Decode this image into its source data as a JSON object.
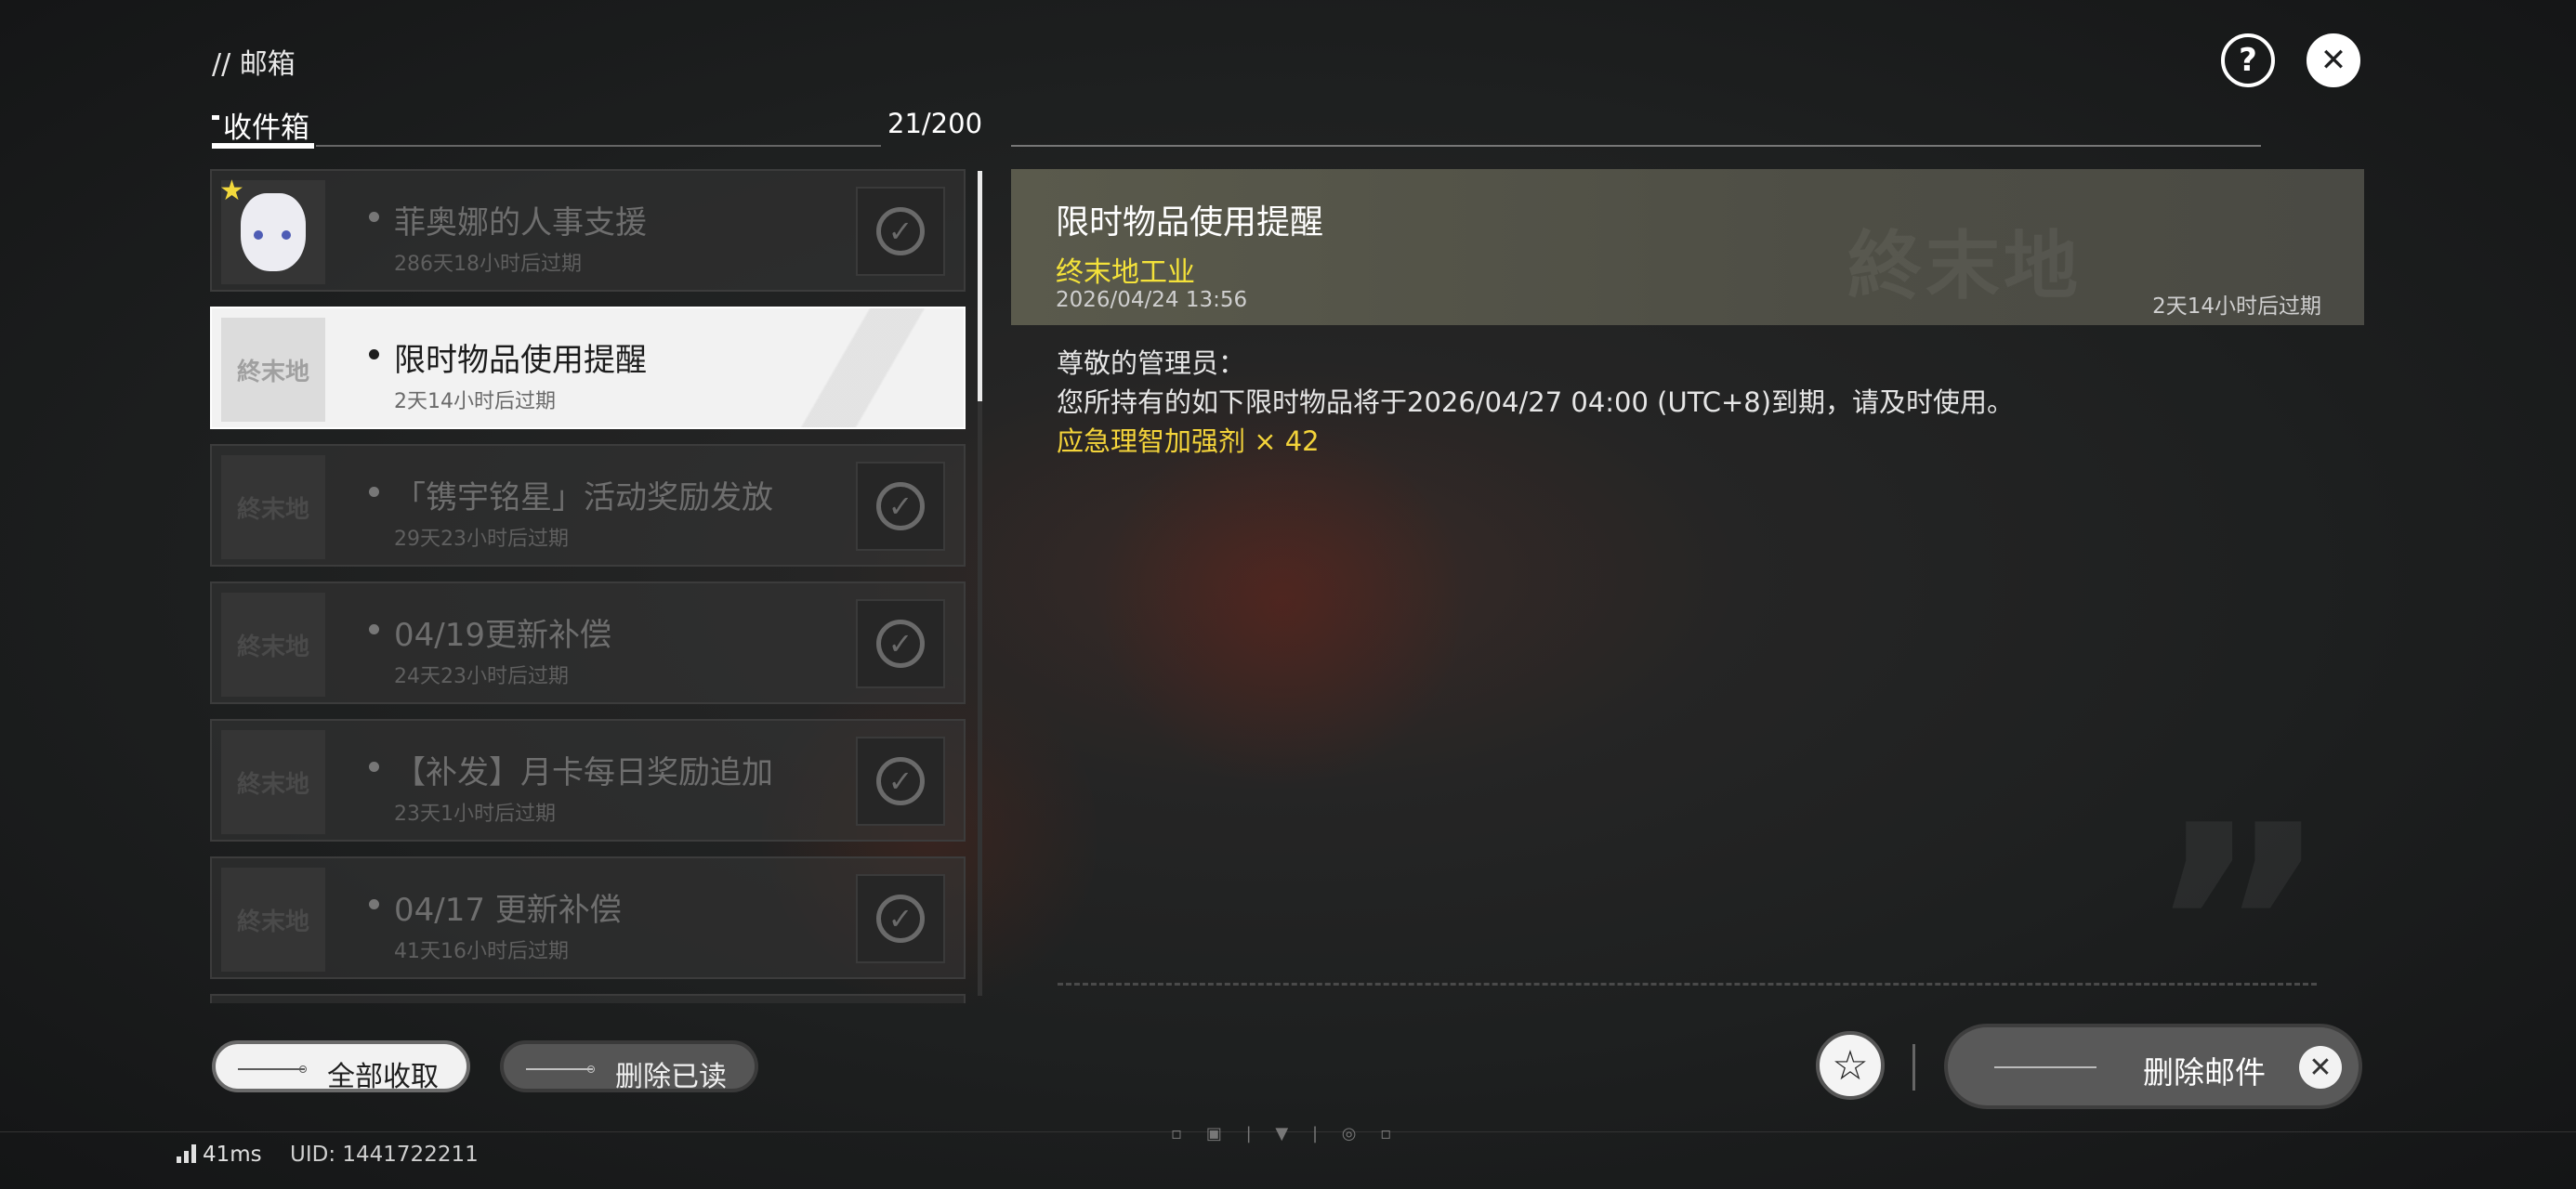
{
  "breadcrumb": "// 邮箱",
  "inbox": {
    "title": "收件箱",
    "count": "21/200"
  },
  "mails": [
    {
      "subject": "菲奥娜的人事支援",
      "expire": "286天18小时后过期",
      "starred": true,
      "avatar": true,
      "active": false,
      "claimed": true
    },
    {
      "subject": "限时物品使用提醒",
      "expire": "2天14小时后过期",
      "starred": false,
      "avatar": false,
      "active": true,
      "claimed": false
    },
    {
      "subject": "「镌宇铭星」活动奖励发放",
      "expire": "29天23小时后过期",
      "starred": false,
      "avatar": false,
      "active": false,
      "claimed": true
    },
    {
      "subject": "04/19更新补偿",
      "expire": "24天23小时后过期",
      "starred": false,
      "avatar": false,
      "active": false,
      "claimed": true
    },
    {
      "subject": "【补发】月卡每日奖励追加",
      "expire": "23天1小时后过期",
      "starred": false,
      "avatar": false,
      "active": false,
      "claimed": true
    },
    {
      "subject": "04/17 更新补偿",
      "expire": "41天16小时后过期",
      "starred": false,
      "avatar": false,
      "active": false,
      "claimed": true
    }
  ],
  "detail": {
    "title": "限时物品使用提醒",
    "sender": "终末地工业",
    "date": "2026/04/24 13:56",
    "expire": "2天14小时后过期",
    "greeting": "尊敬的管理员：",
    "body": "您所持有的如下限时物品将于2026/04/27 04:00 (UTC+8)到期，请及时使用。",
    "item": "应急理智加强剂 × 42"
  },
  "buttons": {
    "claim_all": "全部收取",
    "delete_read": "删除已读",
    "delete_mail": "删除邮件"
  },
  "status": {
    "ping": "41ms",
    "uid": "UID: 1441722211"
  },
  "icons": {
    "help": "question-icon",
    "close": "close-icon",
    "favorite": "star-icon",
    "claimed": "check-circle-icon"
  },
  "colors": {
    "accent_yellow": "#f4e23a",
    "item_yellow": "#f4d43a"
  }
}
